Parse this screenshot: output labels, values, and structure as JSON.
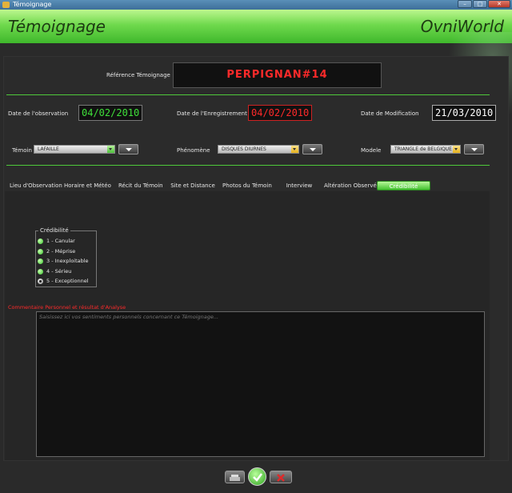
{
  "window": {
    "title": "Témoignage",
    "controls": [
      "–",
      "□",
      "✕"
    ]
  },
  "header": {
    "title": "Témoignage",
    "brand": "OvniWorld"
  },
  "reference": {
    "label": "Référence Témoignage",
    "value": "PERPIGNAN#14"
  },
  "dates": {
    "observation": {
      "label": "Date de l'observation",
      "value": "04/02/2010"
    },
    "enregistrement": {
      "label": "Date de l'Enregistrement",
      "value": "04/02/2010"
    },
    "modification": {
      "label": "Date de Modification",
      "value": "21/03/2010"
    }
  },
  "selectors": {
    "temoin": {
      "label": "Témoin",
      "value": "LAFAILLE"
    },
    "phenomene": {
      "label": "Phénomène",
      "value": "DISQUES DIURNES"
    },
    "modele": {
      "label": "Modele",
      "value": "TRIANGLE de BELGIQUE"
    }
  },
  "tabs": [
    {
      "label": "Lieu d'Observation"
    },
    {
      "label": "Horaire et Météo"
    },
    {
      "label": "Récit du Témoin"
    },
    {
      "label": "Site et Distance"
    },
    {
      "label": "Photos du Témoin"
    },
    {
      "label": "Interview"
    },
    {
      "label": "Altération Observée"
    },
    {
      "label": "Crédibilité"
    }
  ],
  "active_tab": "Crédibilité",
  "credibility": {
    "legend": "Crédibilité",
    "options": [
      {
        "label": "1 - Canular",
        "checked": false
      },
      {
        "label": "2 - Méprise",
        "checked": false
      },
      {
        "label": "3 - Inexploitable",
        "checked": false
      },
      {
        "label": "4 - Sérieu",
        "checked": false
      },
      {
        "label": "5 - Exceptionnel",
        "checked": true
      }
    ]
  },
  "comment": {
    "label": "Commentaire Personnel et résultat d'Analyse",
    "placeholder": "Saisissez ici vos sentiments personnels concernant ce Témoignage..."
  },
  "colors": {
    "accent": "#4ec93a",
    "alert": "#ff2a2a",
    "background": "#2a2a2a"
  }
}
